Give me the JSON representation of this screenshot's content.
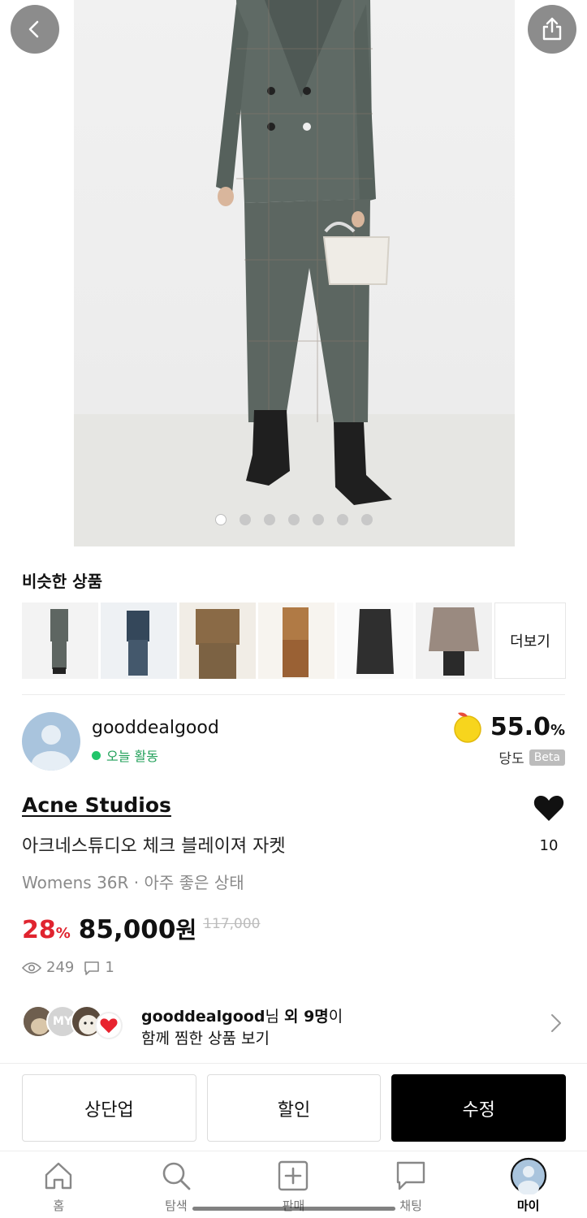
{
  "carousel": {
    "total": 7,
    "active_index": 0
  },
  "similar": {
    "title": "비슷한 상품",
    "more_label": "더보기",
    "items": [
      "similar-1",
      "similar-2",
      "similar-3",
      "similar-4",
      "similar-5",
      "similar-6"
    ]
  },
  "seller": {
    "name": "gooddealgood",
    "activity": "오늘 활동",
    "score": "55.0",
    "score_unit": "%",
    "score_label": "당도",
    "beta": "Beta"
  },
  "product": {
    "brand": "Acne Studios",
    "title": "아크네스튜디오 체크 블레이져 자켓",
    "subtitle": "Womens 36R · 아주 좋은 상태",
    "discount": "28",
    "discount_unit": "%",
    "price": "85,000",
    "currency": "원",
    "original_price": "117,000",
    "likes": "10",
    "views": "249",
    "comments": "1"
  },
  "liked_by": {
    "lead_user": "gooddealgood",
    "suffix_nim": "님",
    "others": "외 9명",
    "suffix_i": "이",
    "line2": "함께 찜한 상품 보기",
    "avatar_text": "MY"
  },
  "actions": {
    "bump": "상단업",
    "discount": "할인",
    "edit": "수정"
  },
  "nav": {
    "home": "홈",
    "explore": "탐색",
    "sell": "판매",
    "chat": "채팅",
    "my": "마이"
  },
  "colors": {
    "accent_red": "#e0242f",
    "online_green": "#22c56a",
    "primary_button": "#000000"
  }
}
